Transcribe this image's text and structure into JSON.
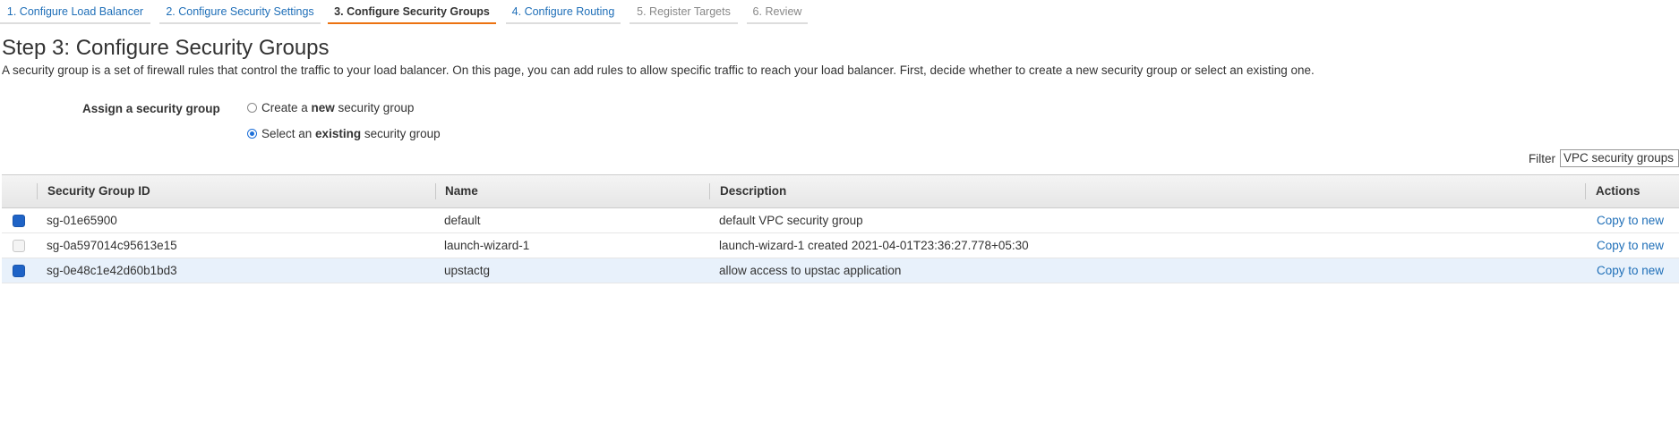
{
  "wizard": {
    "tabs": [
      {
        "label": "1. Configure Load Balancer",
        "state": "link"
      },
      {
        "label": "2. Configure Security Settings",
        "state": "link"
      },
      {
        "label": "3. Configure Security Groups",
        "state": "active"
      },
      {
        "label": "4. Configure Routing",
        "state": "link"
      },
      {
        "label": "5. Register Targets",
        "state": "disabled"
      },
      {
        "label": "6. Review",
        "state": "disabled"
      }
    ]
  },
  "page": {
    "title": "Step 3: Configure Security Groups",
    "description": "A security group is a set of firewall rules that control the traffic to your load balancer. On this page, you can add rules to allow specific traffic to reach your load balancer. First, decide whether to create a new security group or select an existing one."
  },
  "assign": {
    "label": "Assign a security group",
    "options": [
      {
        "prefix": "Create a ",
        "bold": "new",
        "suffix": " security group",
        "checked": false
      },
      {
        "prefix": "Select an ",
        "bold": "existing",
        "suffix": " security group",
        "checked": true
      }
    ]
  },
  "filter": {
    "label": "Filter",
    "value": "VPC security groups"
  },
  "table": {
    "headers": {
      "id": "Security Group ID",
      "name": "Name",
      "description": "Description",
      "actions": "Actions"
    },
    "rows": [
      {
        "id": "sg-01e65900",
        "name": "default",
        "description": "default VPC security group",
        "action": "Copy to new",
        "checked": true,
        "highlight": false
      },
      {
        "id": "sg-0a597014c95613e15",
        "name": "launch-wizard-1",
        "description": "launch-wizard-1 created 2021-04-01T23:36:27.778+05:30",
        "action": "Copy to new",
        "checked": false,
        "highlight": false
      },
      {
        "id": "sg-0e48c1e42d60b1bd3",
        "name": "upstactg",
        "description": "allow access to upstac application",
        "action": "Copy to new",
        "checked": true,
        "highlight": true
      }
    ]
  },
  "colors": {
    "link": "#1f6fb8",
    "active_tab_underline": "#ec7211",
    "checkbox_checked": "#1f63c6",
    "row_highlight": "#e8f1fb"
  }
}
